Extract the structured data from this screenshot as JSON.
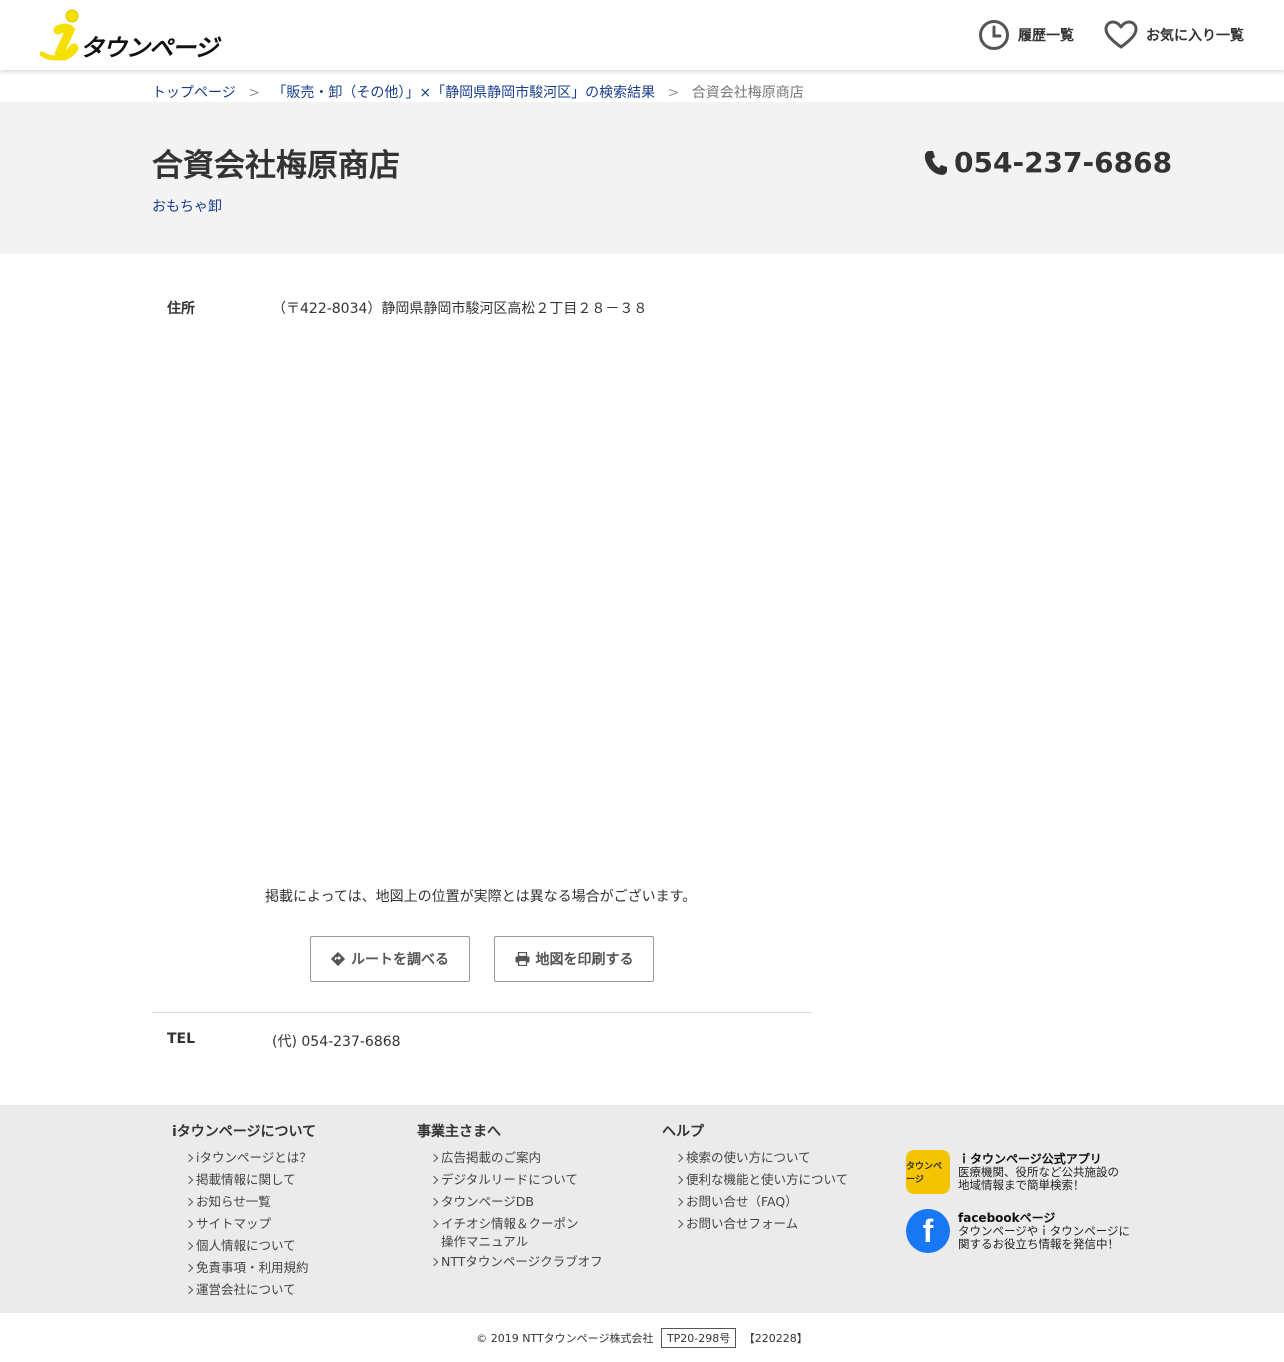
{
  "header": {
    "logo_text": "タウンページ",
    "history_label": "履歴一覧",
    "favorites_label": "お気に入り一覧"
  },
  "breadcrumb": {
    "top": "トップページ",
    "search": "「販売・卸（その他）」×「静岡県静岡市駿河区」の検索結果",
    "current": "合資会社梅原商店",
    "separator": ">"
  },
  "business": {
    "name": "合資会社梅原商店",
    "category": "おもちゃ卸",
    "phone": "054-237-6868"
  },
  "info": {
    "address_label": "住所",
    "address_value": "（〒422-8034）静岡県静岡市駿河区高松２丁目２８－３８",
    "map_note": "掲載によっては、地図上の位置が実際とは異なる場合がございます。",
    "route_button": "ルートを調べる",
    "print_button": "地図を印刷する",
    "tel_label": "TEL",
    "tel_value": "(代) 054-237-6868"
  },
  "footer": {
    "about": {
      "title": "iタウンページについて",
      "items": [
        "iタウンページとは？",
        "掲載情報に関して",
        "お知らせ一覧",
        "サイトマップ",
        "個人情報について",
        "免責事項・利用規約",
        "運営会社について"
      ]
    },
    "business": {
      "title": "事業主さまへ",
      "items": [
        "広告掲載のご案内",
        "デジタルリードについて",
        "タウンページDB",
        "イチオシ情報＆クーポン",
        "NTTタウンページクラブオフ"
      ],
      "item4_line2": "操作マニュアル"
    },
    "help": {
      "title": "ヘルプ",
      "items": [
        "検索の使い方について",
        "便利な機能と使い方について",
        "お問い合せ（FAQ）",
        "お問い合せフォーム"
      ]
    },
    "app_promo": {
      "icon_text": "タウンページ",
      "title": "ｉタウンページ公式アプリ",
      "line1": "医療機関、役所など公共施設の",
      "line2": "地域情報まで簡単検索！"
    },
    "fb_promo": {
      "icon_text": "f",
      "title": "facebookページ",
      "line1": "タウンページやｉタウンページに",
      "line2": "関するお役立ち情報を発信中！"
    }
  },
  "copyright": {
    "text": "© 2019 NTTタウンページ株式会社",
    "code": "TP20-298号",
    "version": "【220228】"
  },
  "colors": {
    "link": "#1a3e8c",
    "logo_yellow": "#f5e000",
    "title_bg": "#f3f3f3",
    "footer_bg": "#ebebeb"
  }
}
